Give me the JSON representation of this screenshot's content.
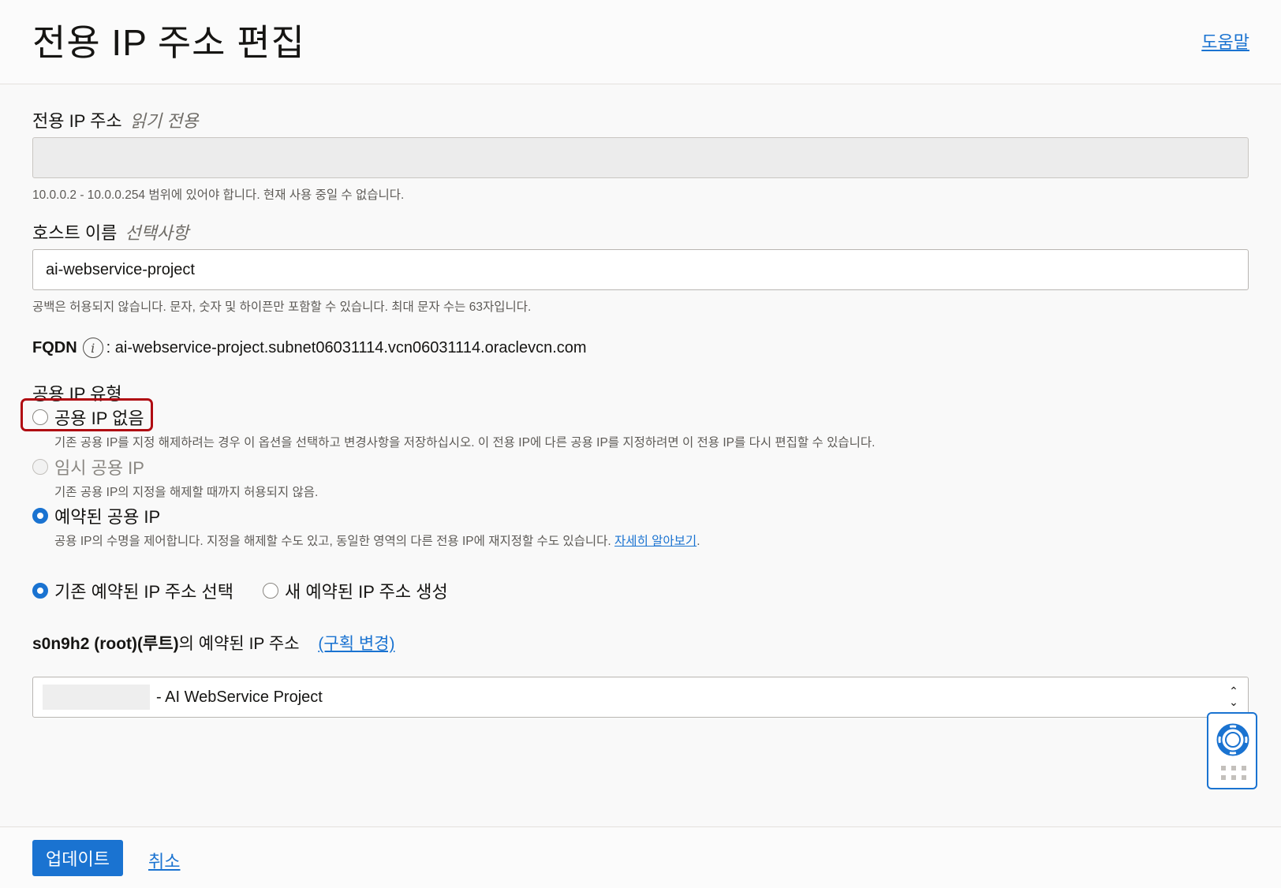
{
  "header": {
    "title": "전용 IP 주소 편집",
    "help": "도움말"
  },
  "private_ip": {
    "label": "전용 IP 주소",
    "hint": "읽기 전용",
    "value": "",
    "helper": "10.0.0.2 - 10.0.0.254 범위에 있어야 합니다. 현재 사용 중일 수 없습니다."
  },
  "hostname": {
    "label": "호스트 이름",
    "hint": "선택사항",
    "value": "ai-webservice-project",
    "helper": "공백은 허용되지 않습니다. 문자, 숫자 및 하이픈만 포함할 수 있습니다. 최대 문자 수는 63자입니다."
  },
  "fqdn": {
    "label": "FQDN",
    "value": "ai-webservice-project.subnet06031114.vcn06031114.oraclevcn.com"
  },
  "public_ip_type": {
    "label": "공용 IP 유형",
    "options": [
      {
        "label": "공용 IP 없음",
        "desc": "기존 공용 IP를 지정 해제하려는 경우 이 옵션을 선택하고 변경사항을 저장하십시오. 이 전용 IP에 다른 공용 IP를 지정하려면 이 전용 IP를 다시 편집할 수 있습니다."
      },
      {
        "label": "임시 공용 IP",
        "desc": "기존 공용 IP의 지정을 해제할 때까지 허용되지 않음."
      },
      {
        "label": "예약된 공용 IP",
        "desc": "공용 IP의 수명을 제어합니다. 지정을 해제할 수도 있고, 동일한 영역의 다른 전용 IP에 재지정할 수도 있습니다.",
        "link": "자세히 알아보기"
      }
    ],
    "selected": "예약된 공용 IP"
  },
  "reserved_choice": {
    "options": [
      "기존 예약된 IP 주소 선택",
      "새 예약된 IP 주소 생성"
    ],
    "selected": "기존 예약된 IP 주소 선택"
  },
  "reserved_select": {
    "label_bold": "s0n9h2 (root)(루트)",
    "label_rest": "의 예약된 IP 주소",
    "change": "(구획 변경)",
    "value": "- AI WebService Project"
  },
  "footer": {
    "update": "업데이트",
    "cancel": "취소"
  },
  "colors": {
    "accent": "#1a73d1",
    "highlight": "#b00b12"
  }
}
